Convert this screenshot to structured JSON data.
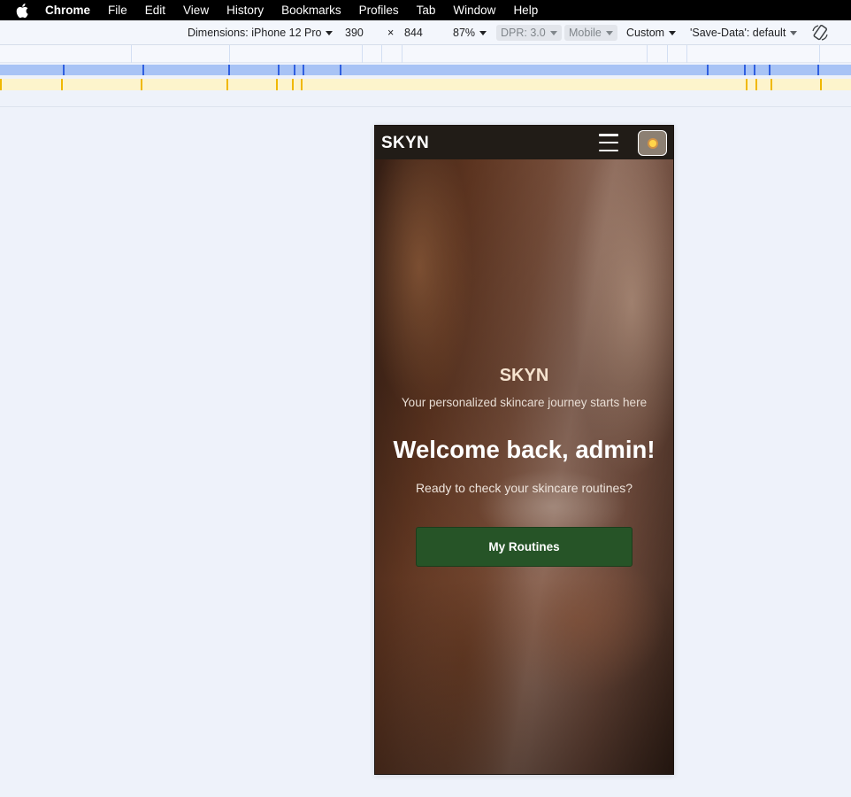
{
  "menubar": {
    "apple_icon": "apple-logo-icon",
    "items": [
      "Chrome",
      "File",
      "Edit",
      "View",
      "History",
      "Bookmarks",
      "Profiles",
      "Tab",
      "Window",
      "Help"
    ]
  },
  "devtools_toolbar": {
    "dimensions_label": "Dimensions: iPhone 12 Pro",
    "width": "390",
    "times": "×",
    "height": "844",
    "zoom": "87%",
    "dpr": "DPR: 3.0",
    "mode": "Mobile",
    "throttle": "Custom",
    "save_data": "'Save-Data': default",
    "rotate_icon": "rotate-device-icon"
  },
  "app": {
    "nav": {
      "brand": "SKYN",
      "menu_icon": "hamburger-menu-icon",
      "theme_icon": "sun-icon"
    },
    "hero": {
      "brand": "SKYN",
      "tagline": "Your personalized skincare journey starts here",
      "welcome": "Welcome back, admin!",
      "subtitle": "Ready to check your skincare routines?",
      "cta_label": "My Routines"
    }
  },
  "colors": {
    "nav_bg": "#211c17",
    "cta_bg": "#265427",
    "brand_text": "#f5e3cf"
  }
}
